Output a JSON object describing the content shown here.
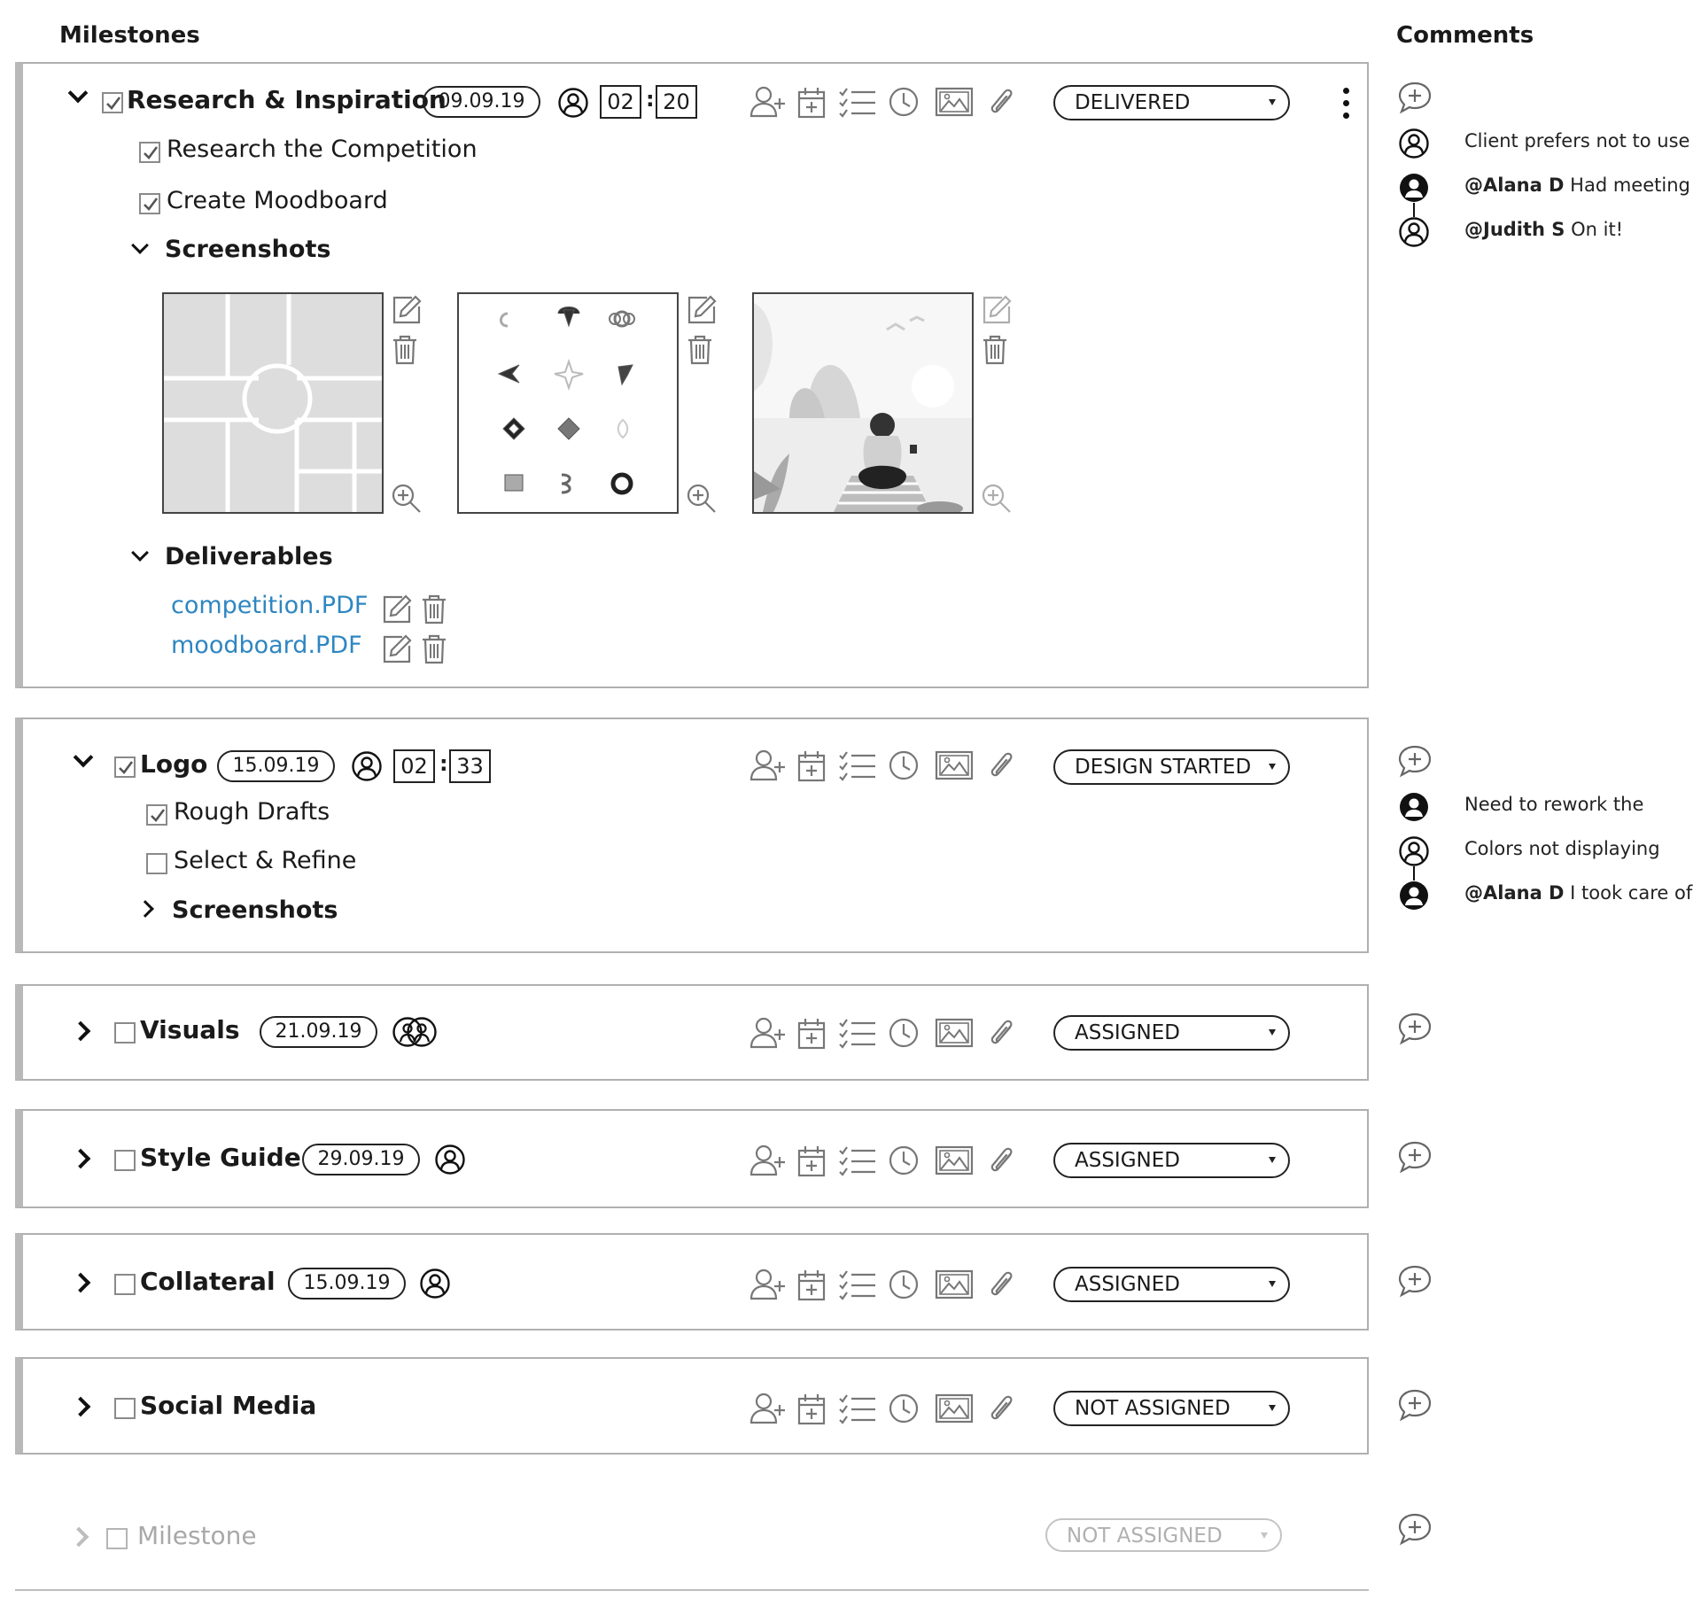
{
  "headings": {
    "milestones": "Milestones",
    "comments": "Comments"
  },
  "milestones": [
    {
      "title": "Research & Inspiration",
      "date": "09.09.19",
      "time_h": "02",
      "time_m": "20",
      "status": "DELIVERED",
      "subtasks": [
        {
          "label": "Research the Competition",
          "checked": true
        },
        {
          "label": "Create Moodboard",
          "checked": true
        }
      ],
      "screenshots_label": "Screenshots",
      "deliverables_label": "Deliverables",
      "deliverables": [
        "competition.PDF",
        "moodboard.PDF"
      ]
    },
    {
      "title": "Logo",
      "date": "15.09.19",
      "time_h": "02",
      "time_m": "33",
      "status": "DESIGN STARTED",
      "subtasks": [
        {
          "label": "Rough Drafts",
          "checked": true
        },
        {
          "label": "Select & Refine",
          "checked": false
        }
      ],
      "screenshots_label": "Screenshots"
    },
    {
      "title": "Visuals",
      "date": "21.09.19",
      "status": "ASSIGNED"
    },
    {
      "title": "Style Guide",
      "date": "29.09.19",
      "status": "ASSIGNED"
    },
    {
      "title": "Collateral",
      "date": "15.09.19",
      "status": "ASSIGNED"
    },
    {
      "title": "Social Media",
      "status": "NOT ASSIGNED"
    },
    {
      "title": "Milestone",
      "status": "NOT ASSIGNED"
    }
  ],
  "comments": {
    "research": [
      {
        "mention": "",
        "text": "Client prefers not to use",
        "avatar": "outline"
      },
      {
        "mention": "@Alana D",
        "text": " Had meeting",
        "avatar": "filled"
      },
      {
        "mention": "@Judith S",
        "text": " On it!",
        "avatar": "outline"
      }
    ],
    "logo": [
      {
        "mention": "",
        "text": "Need to rework the",
        "avatar": "filled"
      },
      {
        "mention": "",
        "text": "Colors not displaying",
        "avatar": "outline"
      },
      {
        "mention": "@Alana D",
        "text": " I took care of",
        "avatar": "filled"
      }
    ]
  },
  "icons": [
    "add-comment-icon",
    "user-icon",
    "group-icon",
    "add-user-icon",
    "calendar-add-icon",
    "checklist-icon",
    "clock-icon",
    "image-icon",
    "paperclip-icon",
    "edit-icon",
    "trash-icon",
    "zoom-in-icon",
    "kebab-menu-icon",
    "chevron-down-icon",
    "chevron-right-icon"
  ]
}
